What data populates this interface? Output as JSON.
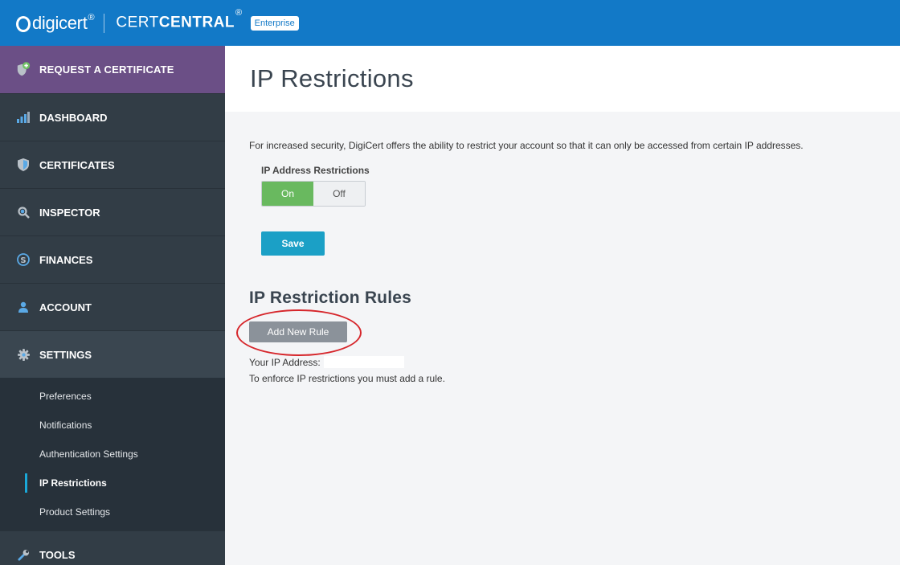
{
  "header": {
    "logo_text": "digicert",
    "logo_reg": "®",
    "product_light": "CERT",
    "product_bold": "CENTRAL",
    "product_reg": "®",
    "edition_badge": "Enterprise"
  },
  "sidebar": {
    "request_label": "REQUEST A CERTIFICATE",
    "items": [
      {
        "label": "DASHBOARD",
        "icon": "bar-chart-icon"
      },
      {
        "label": "CERTIFICATES",
        "icon": "shield-icon"
      },
      {
        "label": "INSPECTOR",
        "icon": "search-icon"
      },
      {
        "label": "FINANCES",
        "icon": "dollar-icon"
      },
      {
        "label": "ACCOUNT",
        "icon": "user-icon"
      },
      {
        "label": "SETTINGS",
        "icon": "gear-icon"
      }
    ],
    "settings_submenu": [
      {
        "label": "Preferences"
      },
      {
        "label": "Notifications"
      },
      {
        "label": "Authentication Settings"
      },
      {
        "label": "IP Restrictions"
      },
      {
        "label": "Product Settings"
      }
    ],
    "tools_label": "TOOLS"
  },
  "main": {
    "title": "IP Restrictions",
    "description": "For increased security, DigiCert offers the ability to restrict your account so that it can only be accessed from certain IP addresses.",
    "toggle_label": "IP Address Restrictions",
    "toggle_on": "On",
    "toggle_off": "Off",
    "save_label": "Save",
    "rules_title": "IP Restriction Rules",
    "add_rule_label": "Add New Rule",
    "your_ip_label": "Your IP Address:",
    "enforce_text": "To enforce IP restrictions you must add a rule."
  },
  "colors": {
    "topbar": "#1279c7",
    "request_bg": "#6b4f86",
    "sidebar_bg": "#323d46",
    "toggle_on": "#69b95f",
    "save_btn": "#1ba0c6",
    "annotation_circle": "#d6262b"
  }
}
